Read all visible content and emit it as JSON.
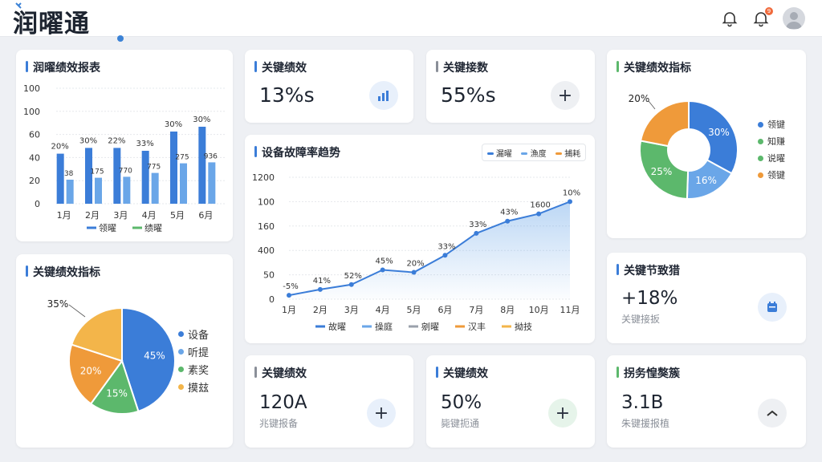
{
  "app": {
    "logo": "润曜通"
  },
  "header": {
    "notif_count": "9"
  },
  "colors": {
    "blue": "#3b7dd8",
    "lightblue": "#6aa6e8",
    "green": "#5cb86c",
    "orange": "#ef9a3a",
    "yellow": "#f3b54a",
    "gray": "#9aa1ab",
    "red": "#f06a3c"
  },
  "cards": {
    "bar": {
      "title": "润曜绩效报表",
      "legend": [
        "领曜",
        "绩曜"
      ],
      "bar_labels": [
        "20%",
        "30%",
        "22%",
        "33%",
        "30%",
        "30%"
      ],
      "inner_labels": [
        "38",
        "175",
        "770",
        "775",
        "275",
        "936"
      ]
    },
    "kpi1": {
      "title": "关键绩效",
      "value": "13%s"
    },
    "kpi2": {
      "title": "关键接数",
      "value": "55%s"
    },
    "donut": {
      "title": "关键绩效指标",
      "labels": [
        "20%",
        "30%",
        "25%",
        "16%"
      ],
      "legend": [
        "领键",
        "知赚",
        "说曜",
        "领键"
      ]
    },
    "line": {
      "title": "设备故障率趋势",
      "top_legend": [
        "漏曜",
        "漁度",
        "捕耗"
      ],
      "point_labels": [
        "-5%",
        "41%",
        "52%",
        "45%",
        "20%",
        "33%",
        "33%",
        "43%",
        "1600",
        "10%"
      ],
      "legend": [
        "故曜",
        "操庭",
        "剜曜",
        "汉丰",
        "拗技"
      ]
    },
    "pie": {
      "title": "关键绩效指标",
      "labels": [
        "35%",
        "20%",
        "15%",
        "45%"
      ],
      "legend": [
        "设备",
        "听提",
        "素奖",
        "摸玆"
      ]
    },
    "kpi3": {
      "title": "关键节致猎",
      "value": "+18%",
      "sub": "关键接扳"
    },
    "kpi4": {
      "title": "关键绩效",
      "value": "120A",
      "sub": "兆键报备"
    },
    "kpi5": {
      "title": "关键绩效",
      "value": "50%",
      "sub": "毙键扼通"
    },
    "kpi6": {
      "title": "拐务惶獒簇",
      "value": "3.1B",
      "sub": "朱键援报植"
    }
  },
  "chart_data": [
    {
      "type": "bar",
      "title": "润曜绩效报表",
      "categories": [
        "1月",
        "2月",
        "3月",
        "4月",
        "5月",
        "6月"
      ],
      "yticks": [
        "100",
        "100",
        "60",
        "40",
        "20",
        "0"
      ],
      "ylim": [
        0,
        120
      ],
      "series": [
        {
          "name": "领曜",
          "values": [
            52,
            58,
            58,
            55,
            75,
            80
          ]
        },
        {
          "name": "绩曜",
          "values": [
            25,
            27,
            28,
            32,
            42,
            43
          ]
        }
      ],
      "legend_position": "bottom"
    },
    {
      "type": "line",
      "title": "设备故障率趋势",
      "categories": [
        "1月",
        "2月",
        "3月",
        "4月",
        "5月",
        "6月",
        "7月",
        "8月",
        "10月",
        "11月"
      ],
      "yticks": [
        "1200",
        "100",
        "160",
        "400",
        "50",
        "0"
      ],
      "values": [
        8,
        20,
        30,
        60,
        55,
        90,
        135,
        160,
        175,
        200
      ],
      "ylim": [
        0,
        250
      ],
      "legend_position": "bottom"
    },
    {
      "type": "pie",
      "title": "关键绩效指标",
      "donut": true,
      "values": [
        30,
        16,
        25,
        20
      ],
      "colors": [
        "#3b7dd8",
        "#6aa6e8",
        "#5cb86c",
        "#ef9a3a"
      ],
      "labels": [
        "30%",
        "16%",
        "25%",
        "20%"
      ]
    },
    {
      "type": "pie",
      "title": "关键绩效指标",
      "donut": false,
      "values": [
        45,
        15,
        20,
        20
      ],
      "colors": [
        "#3b7dd8",
        "#5cb86c",
        "#ef9a3a",
        "#f3b54a"
      ],
      "labels": [
        "45%",
        "15%",
        "20%",
        "35%"
      ]
    }
  ]
}
